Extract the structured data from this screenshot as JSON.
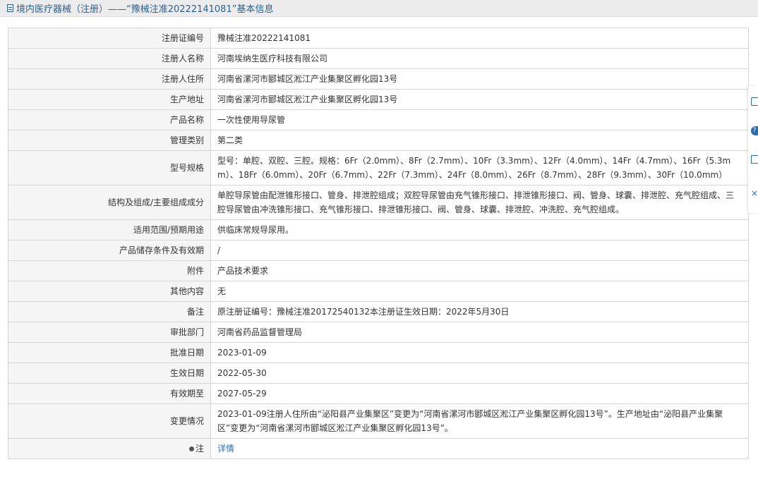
{
  "header": {
    "title": "境内医疗器械（注册）——“豫械注准20222141081”基本信息"
  },
  "rows": [
    {
      "label": "注册证编号",
      "value": "豫械注准20222141081"
    },
    {
      "label": "注册人名称",
      "value": "河南埃纳生医疗科技有限公司"
    },
    {
      "label": "注册人住所",
      "value": "河南省漯河市郾城区淞江产业集聚区孵化园13号"
    },
    {
      "label": "生产地址",
      "value": "河南省漯河市郾城区淞江产业集聚区孵化园13号"
    },
    {
      "label": "产品名称",
      "value": "一次性使用导尿管"
    },
    {
      "label": "管理类别",
      "value": "第二类"
    },
    {
      "label": "型号规格",
      "value": "型号：单腔、双腔、三腔。规格：6Fr（2.0mm）、8Fr（2.7mm）、10Fr（3.3mm）、12Fr（4.0mm）、14Fr（4.7mm）、16Fr（5.3mm）、18Fr（6.0mm）、20Fr（6.7mm）、22Fr（7.3mm）、24Fr（8.0mm）、26Fr（8.7mm）、28Fr（9.3mm）、30Fr（10.0mm）"
    },
    {
      "label": "结构及组成/主要组成成分",
      "value": "单腔导尿管由配泄锥形接口、管身、排泄腔组成；双腔导尿管由充气锥形接口、排泄锥形接口、阀、管身、球囊、排泄腔、充气腔组成、三腔导尿管由冲洗锥形接口、充气锥形接口、排泄锥形接口、阀、管身、球囊、排泄腔、冲洗腔、充气腔组成。"
    },
    {
      "label": "适用范围/预期用途",
      "value": "供临床常规导尿用。"
    },
    {
      "label": "产品储存条件及有效期",
      "value": "/"
    },
    {
      "label": "附件",
      "value": "产品技术要求"
    },
    {
      "label": "其他内容",
      "value": "无"
    },
    {
      "label": "备注",
      "value": "原注册证编号：豫械注准20172540132本注册证生效日期：2022年5月30日"
    },
    {
      "label": "审批部门",
      "value": "河南省药品监督管理局"
    },
    {
      "label": "批准日期",
      "value": "2023-01-09"
    },
    {
      "label": "生效日期",
      "value": "2022-05-30"
    },
    {
      "label": "有效期至",
      "value": "2027-05-29"
    },
    {
      "label": "变更情况",
      "value": "2023-01-09注册人住所由“泌阳县产业集聚区”变更为“河南省漯河市郾城区淞江产业集聚区孵化园13号”。生产地址由“泌阳县产业集聚区”变更为“河南省漯河市郾城区淞江产业集聚区孵化园13号”。"
    }
  ],
  "note_row": {
    "label": "注",
    "link": "详情"
  },
  "side_tools": {
    "icons": [
      "edit-icon",
      "help-icon",
      "copy-icon",
      "close-icon"
    ],
    "help_glyph": "?",
    "close_glyph": "×"
  },
  "colors": {
    "header_text": "#2c5f8e",
    "link": "#2c6db0",
    "label_bg": "#f5f5f5",
    "border": "#d5d5d5"
  }
}
